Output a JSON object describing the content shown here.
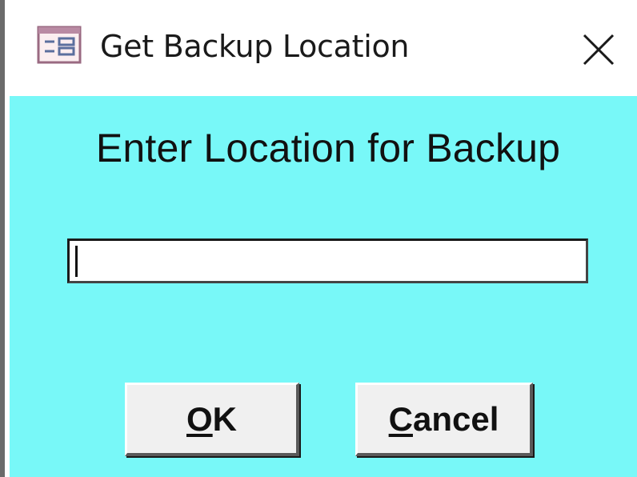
{
  "window": {
    "title": "Get Backup Location",
    "icon": "form-icon",
    "close_icon": "close-icon"
  },
  "dialog": {
    "prompt": "Enter Location for Backup",
    "location_input": {
      "value": "",
      "placeholder": ""
    },
    "buttons": {
      "ok": {
        "mnemonic": "O",
        "rest": "K"
      },
      "cancel": {
        "mnemonic": "C",
        "rest": "ancel"
      }
    }
  },
  "colors": {
    "client_background": "#78f8f8",
    "titlebar_background": "#ffffff",
    "button_face": "#f0f0f0"
  }
}
